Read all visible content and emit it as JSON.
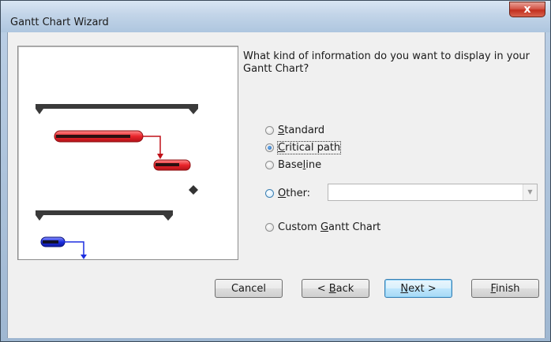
{
  "window": {
    "title": "Gantt Chart Wizard",
    "close_symbol": "x"
  },
  "question": "What kind of information do you want to display in your Gantt Chart?",
  "options": [
    {
      "pre": "",
      "key": "S",
      "post": "tandard",
      "checked": false
    },
    {
      "pre": "",
      "key": "C",
      "post": "ritical path",
      "checked": true
    },
    {
      "pre": "Base",
      "key": "l",
      "post": "ine",
      "checked": false
    },
    {
      "pre": "",
      "key": "O",
      "post": "ther:",
      "checked": false
    },
    {
      "pre": "Custom ",
      "key": "G",
      "post": "antt Chart",
      "checked": false
    }
  ],
  "other_combo": {
    "value": ""
  },
  "buttons": {
    "cancel": {
      "pre": "Cancel",
      "key": "",
      "post": ""
    },
    "back": {
      "pre": "< ",
      "key": "B",
      "post": "ack"
    },
    "next": {
      "pre": "",
      "key": "N",
      "post": "ext >"
    },
    "finish": {
      "pre": "",
      "key": "F",
      "post": "inish"
    }
  },
  "colors": {
    "summary_bar": "#3a3a3a",
    "critical_task": "#e8242a",
    "normal_task": "#1d2ee0",
    "milestone": "#333333"
  }
}
